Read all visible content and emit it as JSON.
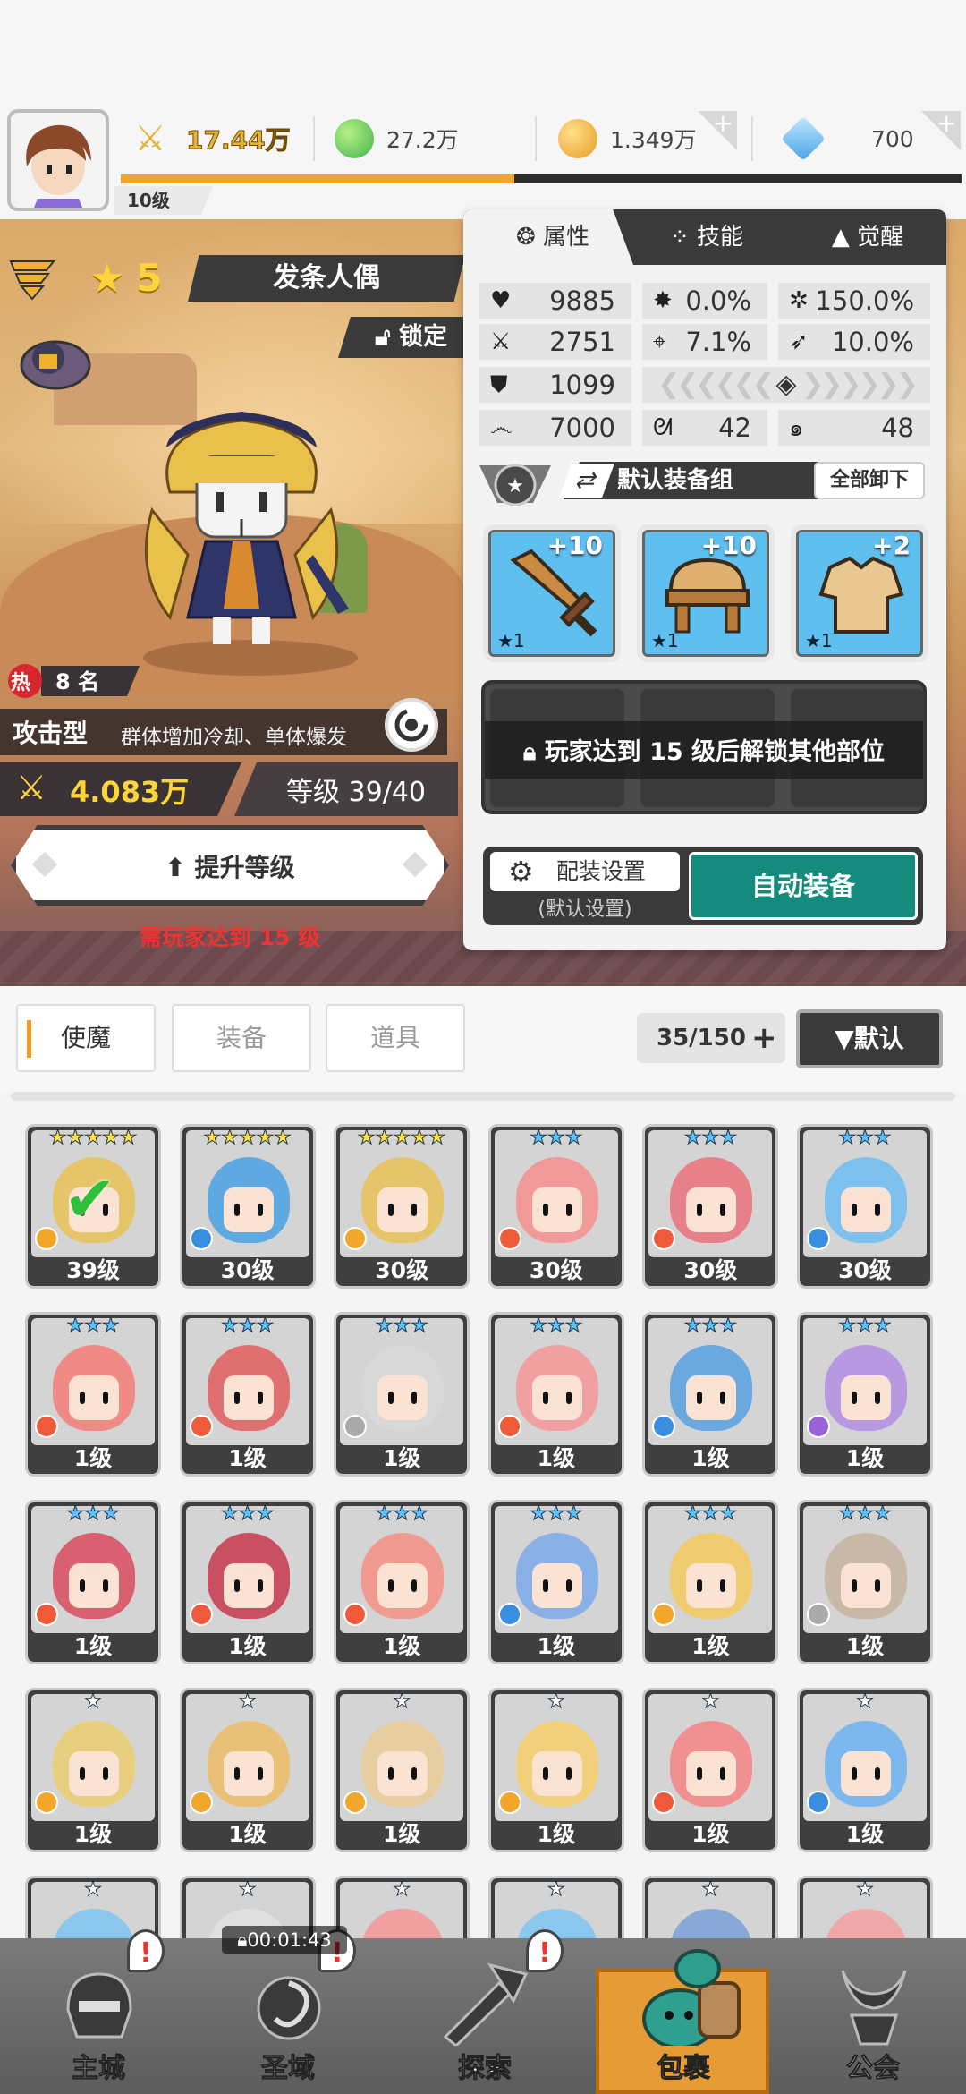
{
  "topbar": {
    "power": "17.44万",
    "gems": "27.2万",
    "gold": "1.349万",
    "crystal": "700",
    "player_level": "10级"
  },
  "hero": {
    "stars": "5",
    "name": "发条人偶",
    "lock_label": "锁定",
    "hot_rank": "8 名",
    "hot_badge": "热",
    "type": "攻击型",
    "type_desc": "群体增加冷却、单体爆发",
    "power": "4.083万",
    "level": "等级 39/40",
    "upgrade_label": "提升等级",
    "upgrade_requirement": "需玩家达到 15 级"
  },
  "panel": {
    "tabs": [
      "属性",
      "技能",
      "觉醒"
    ],
    "stats": {
      "hp": "9885",
      "crit": "0.0%",
      "crit_dmg": "150.0%",
      "atk": "2751",
      "accuracy": "7.1%",
      "speed": "10.0%",
      "def": "1099",
      "stamina": "7000",
      "s1": "42",
      "s2": "48"
    },
    "equip_group": "默认装备组",
    "unequip_all": "全部卸下",
    "equips": [
      {
        "name": "sword",
        "plus": "+10",
        "star": "★1"
      },
      {
        "name": "helmet",
        "plus": "+10",
        "star": "★1"
      },
      {
        "name": "armor",
        "plus": "+2",
        "star": "★1"
      }
    ],
    "locked_text": "玩家达到 15 级后解锁其他部位",
    "loadout_label": "配装设置",
    "loadout_sub": "(默认设置)",
    "auto_equip": "自动装备"
  },
  "inventory": {
    "tabs": [
      "使魔",
      "装备",
      "道具"
    ],
    "capacity": "35/150",
    "sort": "▼默认",
    "cards": [
      {
        "stars": "★★★★★",
        "lv": "39级",
        "bg": "#e6c46a",
        "el": "#f2a72a"
      },
      {
        "stars": "★★★★★",
        "lv": "30级",
        "bg": "#5fa9e3",
        "el": "#3a8ee0"
      },
      {
        "stars": "★★★★★",
        "lv": "30级",
        "bg": "#e6c46a",
        "el": "#f2a72a"
      },
      {
        "stars": "★★★",
        "lv": "30级",
        "bg": "#f29a9a",
        "el": "#ef5a3a"
      },
      {
        "stars": "★★★",
        "lv": "30级",
        "bg": "#e8808a",
        "el": "#ef5a3a"
      },
      {
        "stars": "★★★",
        "lv": "30级",
        "bg": "#7ec0ee",
        "el": "#3a8ee0"
      },
      {
        "stars": "★★★",
        "lv": "1级",
        "bg": "#f08a84",
        "el": "#ef5a3a"
      },
      {
        "stars": "★★★",
        "lv": "1级",
        "bg": "#e07070",
        "el": "#ef5a3a"
      },
      {
        "stars": "★★★",
        "lv": "1级",
        "bg": "#d8d8d8",
        "el": "#aaaaaa"
      },
      {
        "stars": "★★★",
        "lv": "1级",
        "bg": "#f0a0a0",
        "el": "#ef5a3a"
      },
      {
        "stars": "★★★",
        "lv": "1级",
        "bg": "#6aa8e0",
        "el": "#3a8ee0"
      },
      {
        "stars": "★★★",
        "lv": "1级",
        "bg": "#b898e0",
        "el": "#9a62d6"
      },
      {
        "stars": "★★★",
        "lv": "1级",
        "bg": "#d86070",
        "el": "#ef5a3a"
      },
      {
        "stars": "★★★",
        "lv": "1级",
        "bg": "#c85060",
        "el": "#ef5a3a"
      },
      {
        "stars": "★★★",
        "lv": "1级",
        "bg": "#f09a90",
        "el": "#ef5a3a"
      },
      {
        "stars": "★★★",
        "lv": "1级",
        "bg": "#8ab0e8",
        "el": "#3a8ee0"
      },
      {
        "stars": "★★★",
        "lv": "1级",
        "bg": "#f0cc70",
        "el": "#f2a72a"
      },
      {
        "stars": "★★★",
        "lv": "1级",
        "bg": "#c8b8a8",
        "el": "#aaaaaa"
      },
      {
        "stars": "★",
        "lv": "1级",
        "bg": "#e8cf80",
        "el": "#f2a72a"
      },
      {
        "stars": "★",
        "lv": "1级",
        "bg": "#e8c078",
        "el": "#f2a72a"
      },
      {
        "stars": "★",
        "lv": "1级",
        "bg": "#e8cda0",
        "el": "#f2a72a"
      },
      {
        "stars": "★",
        "lv": "1级",
        "bg": "#f0d07a",
        "el": "#f2a72a"
      },
      {
        "stars": "★",
        "lv": "1级",
        "bg": "#f09090",
        "el": "#ef5a3a"
      },
      {
        "stars": "★",
        "lv": "1级",
        "bg": "#7cb8ee",
        "el": "#3a8ee0"
      },
      {
        "stars": "★",
        "lv": "",
        "bg": "#8cc8ee",
        "el": "#3a8ee0"
      },
      {
        "stars": "★",
        "lv": "",
        "bg": "#e0e0e0",
        "el": "#aaaaaa"
      },
      {
        "stars": "★",
        "lv": "",
        "bg": "#f0a0a0",
        "el": "#ef5a3a"
      },
      {
        "stars": "★",
        "lv": "",
        "bg": "#8cc8ee",
        "el": "#3a8ee0"
      },
      {
        "stars": "★",
        "lv": "",
        "bg": "#88a8d8",
        "el": "#3a8ee0"
      },
      {
        "stars": "★",
        "lv": "",
        "bg": "#f0a8a8",
        "el": "#ef5a3a"
      }
    ]
  },
  "nav": {
    "items": [
      "主城",
      "圣域",
      "探索",
      "包裹",
      "公会"
    ],
    "timer": "00:01:43",
    "alert": "!"
  }
}
